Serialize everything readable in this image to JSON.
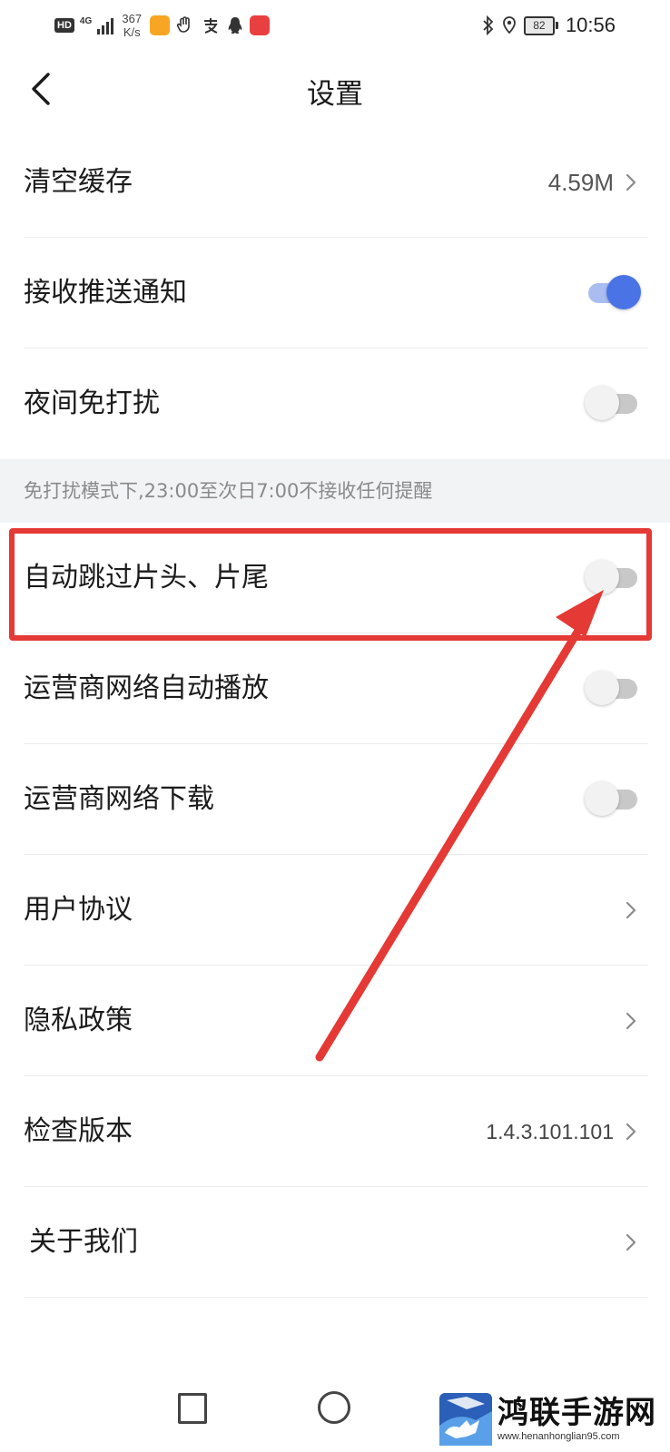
{
  "status_bar": {
    "hd": "HD",
    "network_type": "4G",
    "speed_value": "367",
    "speed_unit": "K/s",
    "battery": "82",
    "time": "10:56"
  },
  "header": {
    "title": "设置"
  },
  "settings": {
    "clear_cache": {
      "label": "清空缓存",
      "value": "4.59M"
    },
    "push_notifications": {
      "label": "接收推送通知",
      "enabled": true
    },
    "night_dnd": {
      "label": "夜间免打扰",
      "enabled": false
    },
    "dnd_note": "免打扰模式下,23:00至次日7:00不接收任何提醒",
    "auto_skip": {
      "label": "自动跳过片头、片尾",
      "enabled": false
    },
    "carrier_autoplay": {
      "label": "运营商网络自动播放",
      "enabled": false
    },
    "carrier_download": {
      "label": "运营商网络下载",
      "enabled": false
    },
    "user_agreement": {
      "label": "用户协议"
    },
    "privacy_policy": {
      "label": "隐私政策"
    },
    "check_version": {
      "label": "检查版本",
      "value": "1.4.3.101.101"
    },
    "about_us": {
      "label": "关于我们"
    }
  },
  "colors": {
    "toggle_on": "#4a73e6",
    "annotation": "#e53935"
  },
  "watermark": {
    "name": "鸿联手游网",
    "url": "www.henanhonglian95.com"
  }
}
